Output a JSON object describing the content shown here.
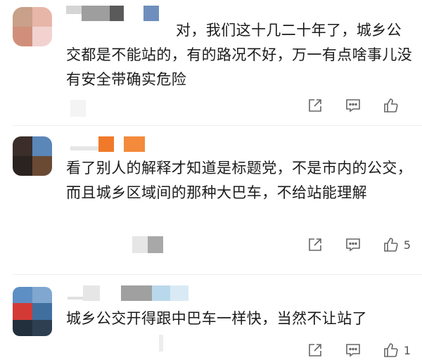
{
  "comments": [
    {
      "text": "对，我们这十几二十年了，城乡公交都是不能站的，有的路况不好，万一有点啥事儿没有安全带确实危险",
      "share_icon": "share-out-icon",
      "reply_icon": "comment-icon",
      "like_icon": "thumbs-up-icon",
      "like_count": "",
      "avatar_colors": [
        "#c9a08a",
        "#e8b6a8",
        "#d08f7a",
        "#f1d2cf"
      ]
    },
    {
      "text": "看了别人的解释才知道是标题党，不是市内的公交，而且城乡区域间的那种大巴车，不给站能理解",
      "share_icon": "share-out-icon",
      "reply_icon": "comment-icon",
      "like_icon": "thumbs-up-icon",
      "like_count": "5",
      "avatar_colors": [
        "#3b2e2a",
        "#5a86b8",
        "#2a2320",
        "#6b4a34"
      ]
    },
    {
      "text": "城乡公交开得跟中巴车一样快，当然不让站了",
      "share_icon": "share-out-icon",
      "reply_icon": "comment-icon",
      "like_icon": "thumbs-up-icon",
      "like_count": "1",
      "avatar_colors": [
        "#5e8fc4",
        "#7fa7cf",
        "#d43a35",
        "#3f6f9f"
      ]
    }
  ]
}
